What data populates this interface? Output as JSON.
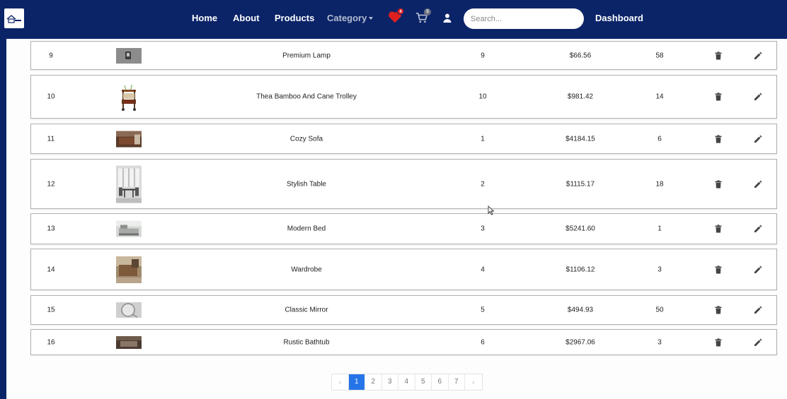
{
  "nav": {
    "links": {
      "home": "Home",
      "about": "About",
      "products": "Products",
      "category": "Category",
      "dashboard": "Dashboard"
    },
    "wishlist_count": "4",
    "cart_count": "5",
    "search_placeholder": "Search..."
  },
  "colors": {
    "navbar": "#0b2468",
    "active_page": "#2575e8",
    "wishlist": "#e02020"
  },
  "products": [
    {
      "id": "9",
      "name": "Premium Lamp",
      "category_id": "9",
      "price": "$66.56",
      "stock": "58",
      "image": "lamp-photo"
    },
    {
      "id": "10",
      "name": "Thea Bamboo And Cane Trolley",
      "category_id": "10",
      "price": "$981.42",
      "stock": "14",
      "image": "trolley-photo"
    },
    {
      "id": "11",
      "name": "Cozy Sofa",
      "category_id": "1",
      "price": "$4184.15",
      "stock": "6",
      "image": "sofa-photo"
    },
    {
      "id": "12",
      "name": "Stylish Table",
      "category_id": "2",
      "price": "$1115.17",
      "stock": "18",
      "image": "table-photo"
    },
    {
      "id": "13",
      "name": "Modern Bed",
      "category_id": "3",
      "price": "$5241.60",
      "stock": "1",
      "image": "bed-photo"
    },
    {
      "id": "14",
      "name": "Wardrobe",
      "category_id": "4",
      "price": "$1106.12",
      "stock": "3",
      "image": "wardrobe-photo"
    },
    {
      "id": "15",
      "name": "Classic Mirror",
      "category_id": "5",
      "price": "$494.93",
      "stock": "50",
      "image": "mirror-photo"
    },
    {
      "id": "16",
      "name": "Rustic Bathtub",
      "category_id": "6",
      "price": "$2967.06",
      "stock": "3",
      "image": "bathtub-photo"
    }
  ],
  "pagination": {
    "prev": "‹",
    "next": "›",
    "pages": [
      "1",
      "2",
      "3",
      "4",
      "5",
      "6",
      "7"
    ],
    "current": "1"
  }
}
